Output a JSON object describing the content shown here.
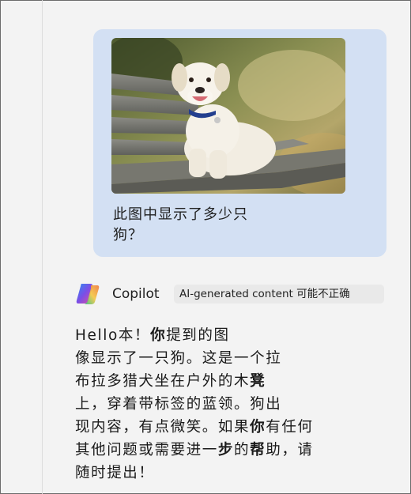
{
  "user_message": {
    "line1": "此图中显示了多少只",
    "line2": "狗？"
  },
  "assistant": {
    "name": "Copilot",
    "badge": "AI-generated content 可能不正确",
    "reply": {
      "l1a": "Hello本！",
      "l1b": "你",
      "l1c": "提到的图",
      "l2": "像显示了一只狗。这是一个拉",
      "l3a": "布拉多猎犬坐在户外的木",
      "l3b": "凳",
      "l4": "上，穿着带标签的蓝领。狗出",
      "l5a": "现内容，有点微笑。如果",
      "l5b": "你",
      "l5c": "有任何",
      "l6a": "其他问题或需要进一",
      "l6b": "步",
      "l6c": "的",
      "l6d": "帮",
      "l6e": "助，请",
      "l7": "随时提出！"
    }
  },
  "colors": {
    "background": "#f3f3f3",
    "user_bubble": "#d3e0f3",
    "badge_bg": "#e9e9e9"
  }
}
